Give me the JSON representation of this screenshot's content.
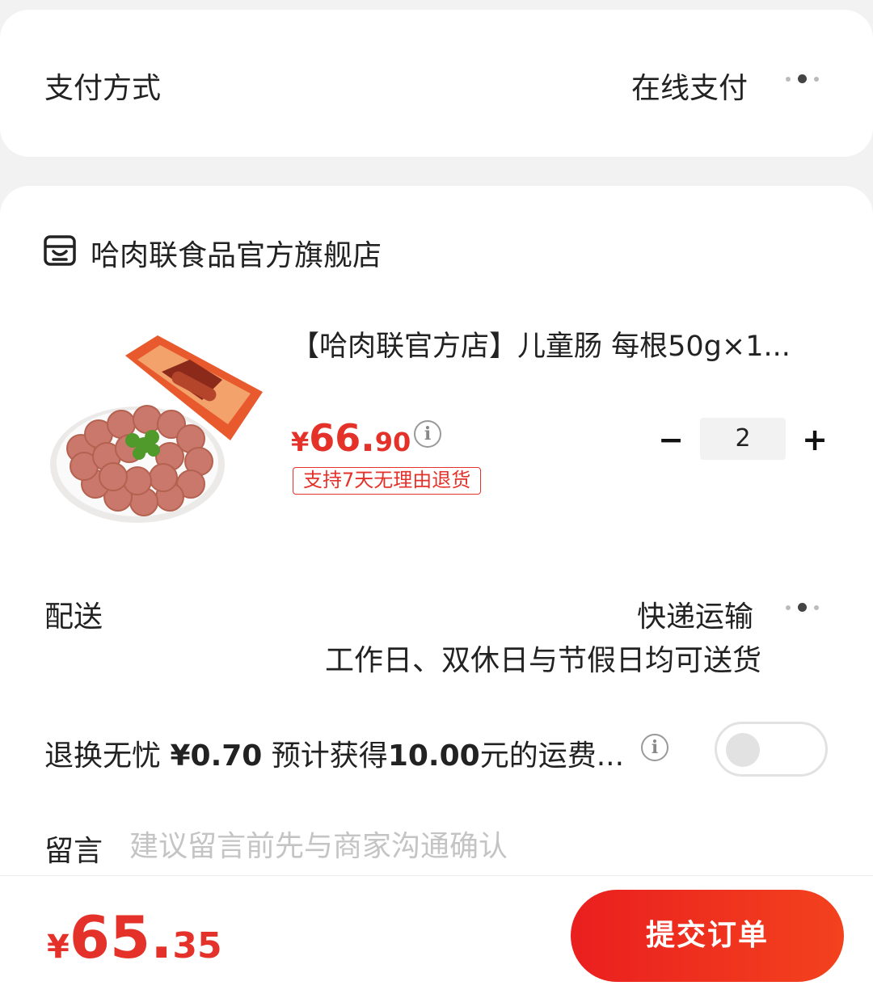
{
  "payment": {
    "label": "支付方式",
    "value": "在线支付"
  },
  "shop": {
    "name": "哈肉联食品官方旗舰店",
    "icon": "store-icon"
  },
  "product": {
    "title": "【哈肉联官方店】儿童肠 每根50g×1...",
    "image_icon": "sausage-product-image",
    "price_symbol": "¥",
    "price_int": "66.",
    "price_dec": "90",
    "return_tag": "支持7天无理由退货",
    "quantity": "2",
    "minus": "−",
    "plus": "+"
  },
  "delivery": {
    "label": "配送",
    "method": "快递运输",
    "desc": "工作日、双休日与节假日均可送货"
  },
  "return_insurance": {
    "label": "退换无忧",
    "fee": "¥0.70",
    "desc_prefix": "预计获得",
    "desc_amount": "10.00",
    "desc_suffix": "元的运费...",
    "enabled": false
  },
  "message": {
    "label": "留言",
    "placeholder": "建议留言前先与商家沟通确认"
  },
  "footer": {
    "total_symbol": "¥",
    "total_int": "65.",
    "total_dec": "35",
    "submit_label": "提交订单"
  },
  "colors": {
    "accent": "#e4322b",
    "button_start": "#ea1f1f",
    "button_end": "#f3421e"
  }
}
